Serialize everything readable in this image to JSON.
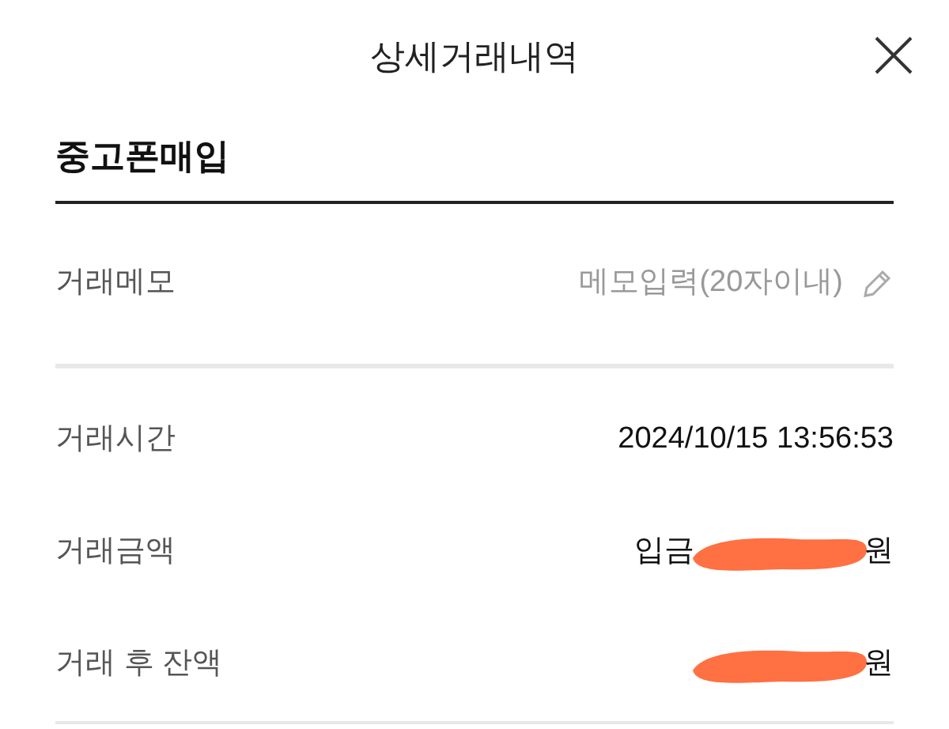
{
  "header": {
    "title": "상세거래내역"
  },
  "transaction": {
    "name": "중고폰매입"
  },
  "memo": {
    "label": "거래메모",
    "placeholder": "메모입력(20자이내)"
  },
  "details": [
    {
      "label": "거래시간",
      "value_start": "2024/10/15 13:56:53"
    },
    {
      "label": "거래금액",
      "value_start": "입금",
      "value_end": "원",
      "redacted": true
    },
    {
      "label": "거래 후 잔액",
      "value_end": "원",
      "redacted": true
    }
  ]
}
